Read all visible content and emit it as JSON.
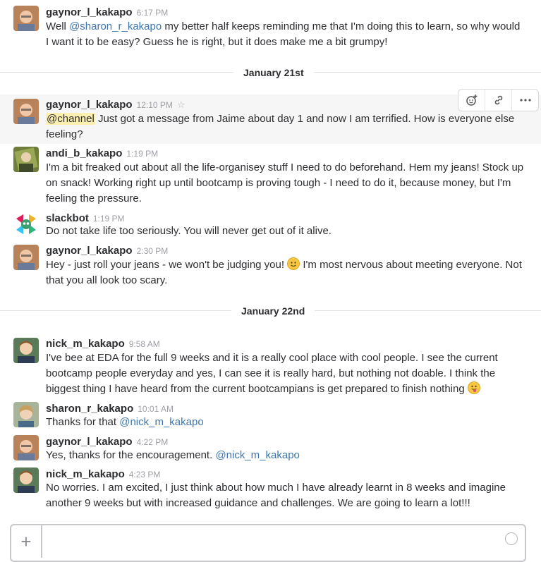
{
  "messages": [
    {
      "user": "gaynor_l_kakapo",
      "time": "6:17 PM",
      "pre": "Well ",
      "mention": "@sharon_r_kakapo",
      "post": "  my better half keeps reminding me that I'm doing  this to learn, so why would I want it to be easy?  Guess he is right, but it does make me a bit grumpy!"
    },
    {
      "user": "gaynor_l_kakapo",
      "time": "12:10 PM",
      "channel": "@channel",
      "post": " Just got a message from Jaime about day 1 and now I am terrified.  How is everyone else feeling?"
    },
    {
      "user": "andi_b_kakapo",
      "time": "1:19 PM",
      "text": "I'm a bit freaked out about all the life-organisey stuff I need to do beforehand. Hem my jeans! Stock up on snack! Working right up until bootcamp is proving tough - I need to do it, because money, but I'm feeling the pressure."
    },
    {
      "user": "slackbot",
      "time": "1:19 PM",
      "text": "Do not take life too seriously. You will never get out of it alive."
    },
    {
      "user": "gaynor_l_kakapo",
      "time": "2:30 PM",
      "pre": "Hey - just roll your jeans - we won't be judging you! ",
      "post": " I'm most nervous about meeting everyone.  Not that you all look too scary."
    },
    {
      "user": "nick_m_kakapo",
      "time": "9:58 AM",
      "pre": "I've bee at EDA for the full 9 weeks and it is a really cool place with cool people. I see the current bootcamp people everyday and yes, I can see it is really hard, but nothing not doable. I think the biggest thing I have heard from the current bootcampians is get prepared to finish nothing "
    },
    {
      "user": "sharon_r_kakapo",
      "time": "10:01 AM",
      "pre": "Thanks for that ",
      "mention": "@nick_m_kakapo"
    },
    {
      "user": "gaynor_l_kakapo",
      "time": "4:22 PM",
      "pre": "Yes, thanks for the encouragement. ",
      "mention": "@nick_m_kakapo"
    },
    {
      "user": "nick_m_kakapo",
      "time": "4:23 PM",
      "text": "No worries. I am excited, I just think about how much I have already learnt in 8 weeks and imagine another 9 weeks but with increased guidance and challenges. We are going to learn a lot!!!"
    }
  ],
  "dividers": [
    "January 21st",
    "January 22nd"
  ],
  "icons": {
    "star": "star-icon",
    "add_reaction": "add-reaction-icon",
    "link": "link-icon",
    "more": "more-actions-icon",
    "smiley": "smiley-emoji",
    "tongue": "tongue-emoji",
    "plus": "plus-icon",
    "composer_emoji": "emoji-picker-icon"
  },
  "colors": {
    "mention": "#3d75b0",
    "channel_highlight": "#fcefb0",
    "hover_row": "#f6f6f6"
  }
}
